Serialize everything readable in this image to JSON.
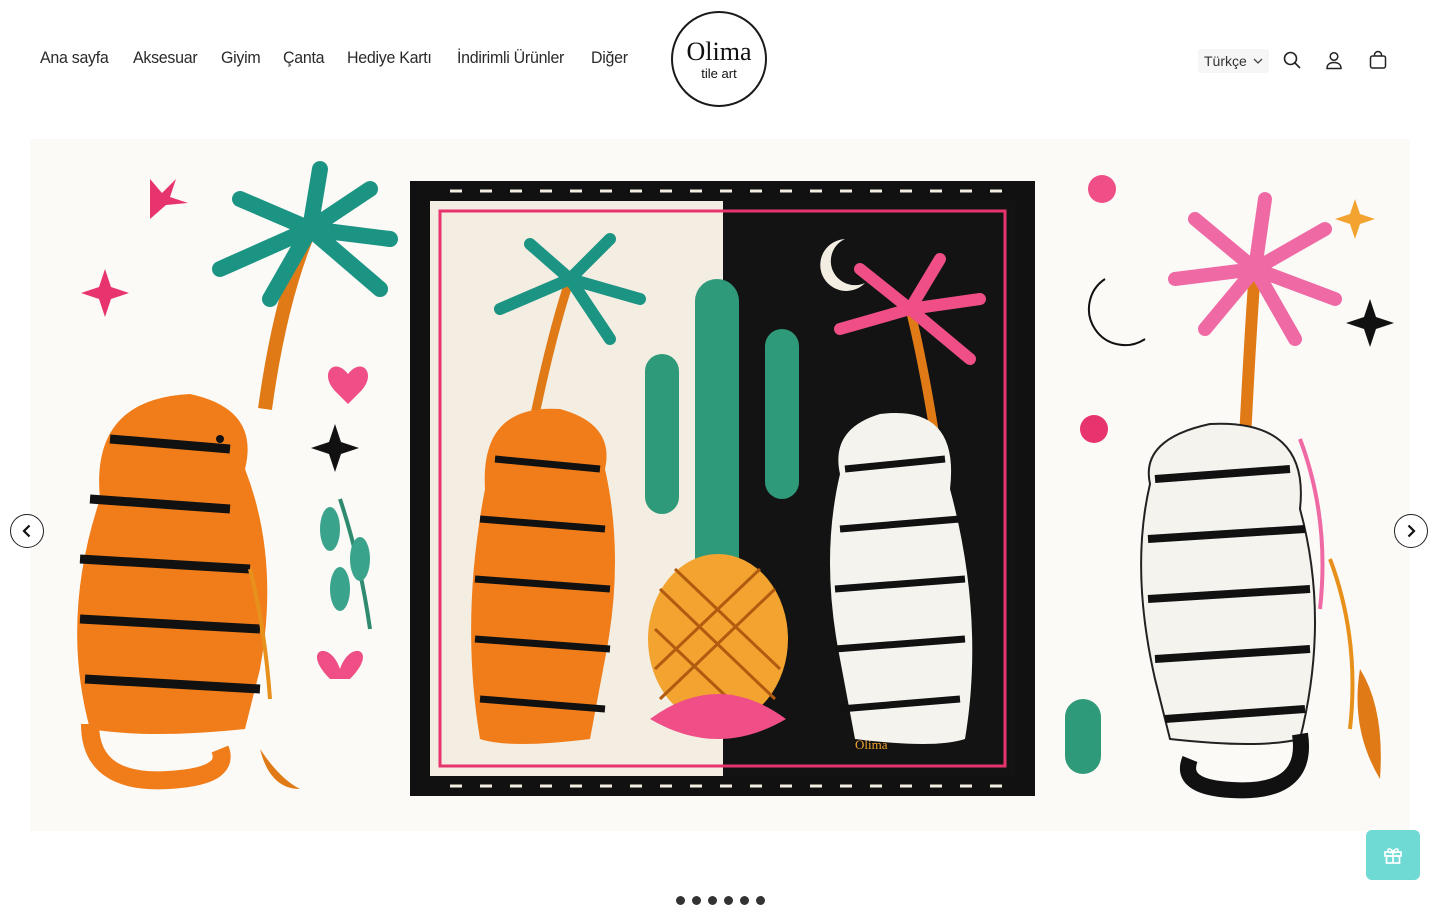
{
  "nav": {
    "items": [
      {
        "label": "Ana sayfa"
      },
      {
        "label": "Aksesuar"
      },
      {
        "label": "Giyim"
      },
      {
        "label": "Çanta"
      },
      {
        "label": "Hediye Kartı"
      },
      {
        "label": "İndirimli Ürünler"
      },
      {
        "label": "Diğer"
      }
    ]
  },
  "logo": {
    "name": "Olima",
    "tagline": "tile art"
  },
  "header": {
    "language": "Türkçe"
  },
  "hero": {
    "scarf_signature": "Olima",
    "slide_count": 6
  },
  "icons": {
    "search": "search-icon",
    "account": "user-icon",
    "cart": "bag-icon",
    "prev": "chevron-left-icon",
    "next": "chevron-right-icon",
    "gift": "gift-icon"
  },
  "colors": {
    "accent": "#6fd9d4",
    "tiger_orange": "#f07d1a",
    "teal": "#1f9a8a",
    "pink": "#ee4d8c"
  }
}
